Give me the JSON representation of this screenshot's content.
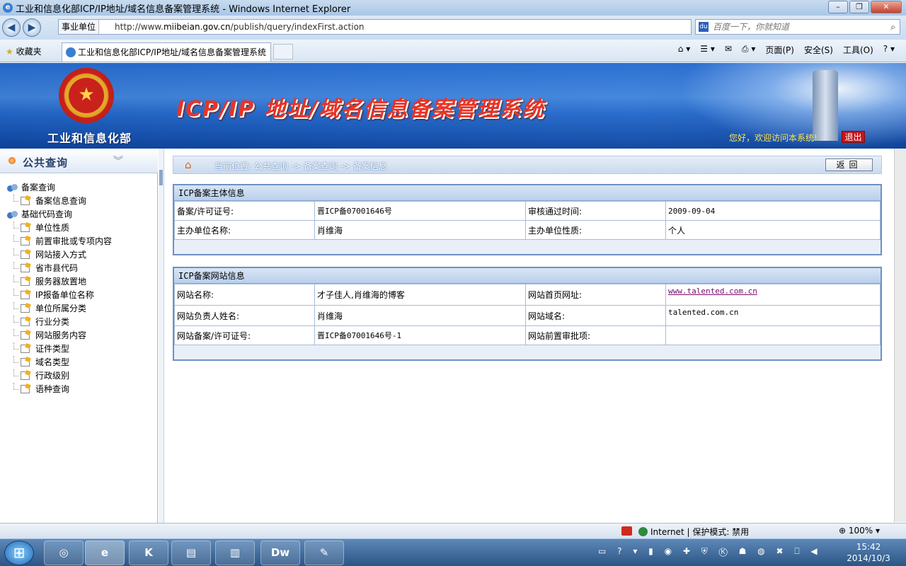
{
  "browser": {
    "window_title": "工业和信息化部ICP/IP地址/域名信息备案管理系统 - Windows Internet Explorer",
    "zone_label": "事业单位",
    "url_prefix": "http://www.",
    "url_domain": "miibeian.gov.cn",
    "url_path": "/publish/query/indexFirst.action",
    "search_placeholder": "百度一下，你就知道",
    "favorites_label": "收藏夹",
    "tab_title": "工业和信息化部ICP/IP地址/域名信息备案管理系统",
    "menu": {
      "page": "页面(P)",
      "safety": "安全(S)",
      "tools": "工具(O)"
    }
  },
  "header": {
    "ministry": "工业和信息化部",
    "system_title": "ICP/IP 地址/域名信息备案管理系统",
    "welcome": "您好，欢迎访问本系统!",
    "logout": "退出"
  },
  "sidebar": {
    "title": "公共查询",
    "groups": [
      {
        "label": "备案查询",
        "items": [
          "备案信息查询"
        ]
      },
      {
        "label": "基础代码查询",
        "items": [
          "单位性质",
          "前置审批或专项内容",
          "网站接入方式",
          "省市县代码",
          "服务器放置地",
          "IP报备单位名称",
          "单位所属分类",
          "行业分类",
          "网站服务内容",
          "证件类型",
          "域名类型",
          "行政级别",
          "语种查询"
        ]
      }
    ]
  },
  "breadcrumb": {
    "text": "当前位置: 公共查询  ->  备案查询  ->  备案信息",
    "back": "返回"
  },
  "subject_panel": {
    "title": "ICP备案主体信息",
    "license_label": "备案/许可证号:",
    "license_value": "晋ICP备07001646号",
    "approve_label": "审核通过时间:",
    "approve_value": "2009-09-04",
    "org_label": "主办单位名称:",
    "org_value": "肖维海",
    "nature_label": "主办单位性质:",
    "nature_value": "个人"
  },
  "site_panel": {
    "title": "ICP备案网站信息",
    "name_label": "网站名称:",
    "name_value": "才子佳人,肖维海的博客",
    "home_label": "网站首页网址:",
    "home_value": "www.talented.com.cn",
    "owner_label": "网站负责人姓名:",
    "owner_value": "肖维海",
    "domain_label": "网站域名:",
    "domain_value": "talented.com.cn",
    "site_license_label": "网站备案/许可证号:",
    "site_license_value": "晋ICP备07001646号-1",
    "preapprove_label": "网站前置审批项:",
    "preapprove_value": ""
  },
  "statusbar": {
    "zone": "Internet | 保护模式: 禁用",
    "zoom": "100%"
  },
  "taskbar": {
    "time": "15:42",
    "date": "2014/10/3",
    "dw_label": "Dw"
  }
}
